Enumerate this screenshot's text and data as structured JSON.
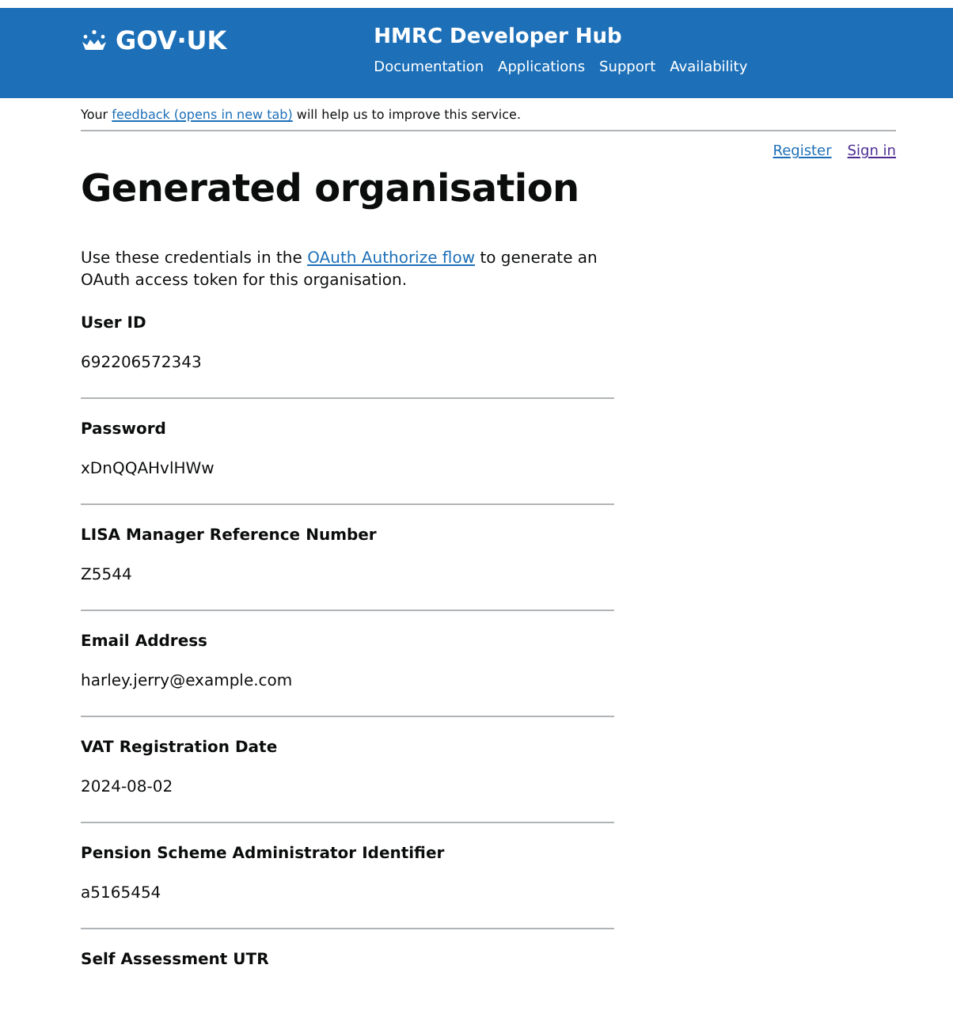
{
  "header": {
    "logo": "GOV·UK",
    "service": "HMRC Developer Hub",
    "nav": [
      {
        "label": "Documentation"
      },
      {
        "label": "Applications"
      },
      {
        "label": "Support"
      },
      {
        "label": "Availability"
      }
    ]
  },
  "feedback": {
    "before": "Your",
    "link": "feedback (opens in new tab)",
    "after": "will help us to improve this service."
  },
  "account_links": [
    {
      "label": "Register",
      "visited": false
    },
    {
      "label": "Sign in",
      "visited": true
    }
  ],
  "title": "Generated organisation",
  "intro": {
    "before": "Use these credentials in the",
    "link": "OAuth Authorize flow",
    "after": "to generate an OAuth access token for this organisation."
  },
  "fields": [
    {
      "label": "User ID",
      "value": "692206572343"
    },
    {
      "label": "Password",
      "value": "xDnQQAHvlHWw"
    },
    {
      "label": "LISA Manager Reference Number",
      "value": "Z5544"
    },
    {
      "label": "Email Address",
      "value": "harley.jerry@example.com"
    },
    {
      "label": "VAT Registration Date",
      "value": "2024-08-02"
    },
    {
      "label": "Pension Scheme Administrator Identifier",
      "value": "a5165454"
    },
    {
      "label": "Self Assessment UTR"
    }
  ]
}
